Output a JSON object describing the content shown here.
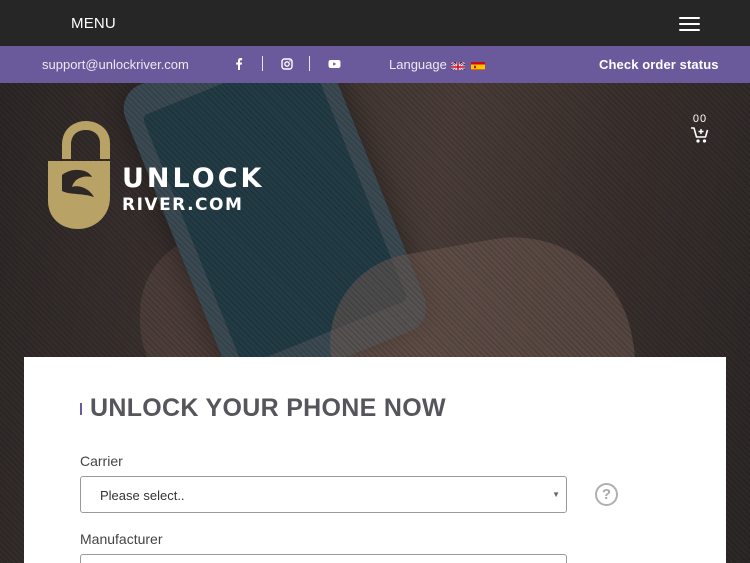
{
  "topnav": {
    "menu_label": "MENU",
    "hamburger_icon": "hamburger-icon"
  },
  "infobar": {
    "email": "support@unlockriver.com",
    "social_icons": [
      "facebook-icon",
      "instagram-icon",
      "youtube-icon"
    ],
    "language_label": "Language",
    "flags": [
      "uk-flag-icon",
      "spain-flag-icon"
    ],
    "check_order_label": "Check order status"
  },
  "logo": {
    "line1": "UNLOCK",
    "line2": "RIVER.COM"
  },
  "cart": {
    "count": "00",
    "icon": "cart-icon"
  },
  "form": {
    "title": "UNLOCK YOUR PHONE NOW",
    "carrier_label": "Carrier",
    "carrier_value": "Please select..",
    "manufacturer_label": "Manufacturer",
    "help_glyph": "?"
  },
  "colors": {
    "topnav_bg": "#262626",
    "infobar_bg": "#6b5a9b",
    "logo_gold": "#b9a266",
    "title_text": "#55555b"
  }
}
